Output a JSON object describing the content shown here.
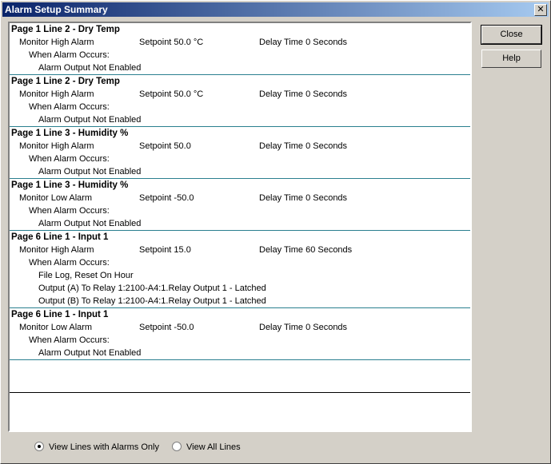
{
  "window": {
    "title": "Alarm Setup Summary",
    "close_glyph": "✕"
  },
  "buttons": {
    "close": "Close",
    "help": "Help"
  },
  "radios": [
    {
      "label": "View Lines with Alarms Only",
      "checked": true
    },
    {
      "label": "View All Lines",
      "checked": false
    }
  ],
  "sections": [
    {
      "heading": "Page 1 Line 2 - Dry Temp",
      "monitor": "Monitor High Alarm",
      "setpoint": "Setpoint 50.0 °C",
      "delay": "Delay Time 0 Seconds",
      "when": "When Alarm Occurs:",
      "actions": [
        "Alarm Output Not Enabled"
      ]
    },
    {
      "heading": "Page 1 Line 2 - Dry Temp",
      "monitor": "Monitor High Alarm",
      "setpoint": "Setpoint 50.0 °C",
      "delay": "Delay Time 0 Seconds",
      "when": "When Alarm Occurs:",
      "actions": [
        "Alarm Output Not Enabled"
      ]
    },
    {
      "heading": "Page 1 Line 3 - Humidity %",
      "monitor": "Monitor High Alarm",
      "setpoint": "Setpoint 50.0",
      "delay": "Delay Time 0 Seconds",
      "when": "When Alarm Occurs:",
      "actions": [
        "Alarm Output Not Enabled"
      ]
    },
    {
      "heading": "Page 1 Line 3 - Humidity %",
      "monitor": "Monitor Low Alarm",
      "setpoint": "Setpoint -50.0",
      "delay": "Delay Time 0 Seconds",
      "when": "When Alarm Occurs:",
      "actions": [
        "Alarm Output Not Enabled"
      ]
    },
    {
      "heading": "Page 6 Line 1 - Input 1",
      "monitor": "Monitor High Alarm",
      "setpoint": "Setpoint 15.0",
      "delay": "Delay Time 60 Seconds",
      "when": "When Alarm Occurs:",
      "actions": [
        "File Log, Reset On Hour",
        "Output (A) To Relay 1:2100-A4:1.Relay Output 1 - Latched",
        "Output (B) To Relay 1:2100-A4:1.Relay Output 1 - Latched"
      ]
    },
    {
      "heading": "Page 6 Line 1 - Input 1",
      "monitor": "Monitor Low Alarm",
      "setpoint": "Setpoint -50.0",
      "delay": "Delay Time 0 Seconds",
      "when": "When Alarm Occurs:",
      "actions": [
        "Alarm Output Not Enabled"
      ]
    }
  ]
}
